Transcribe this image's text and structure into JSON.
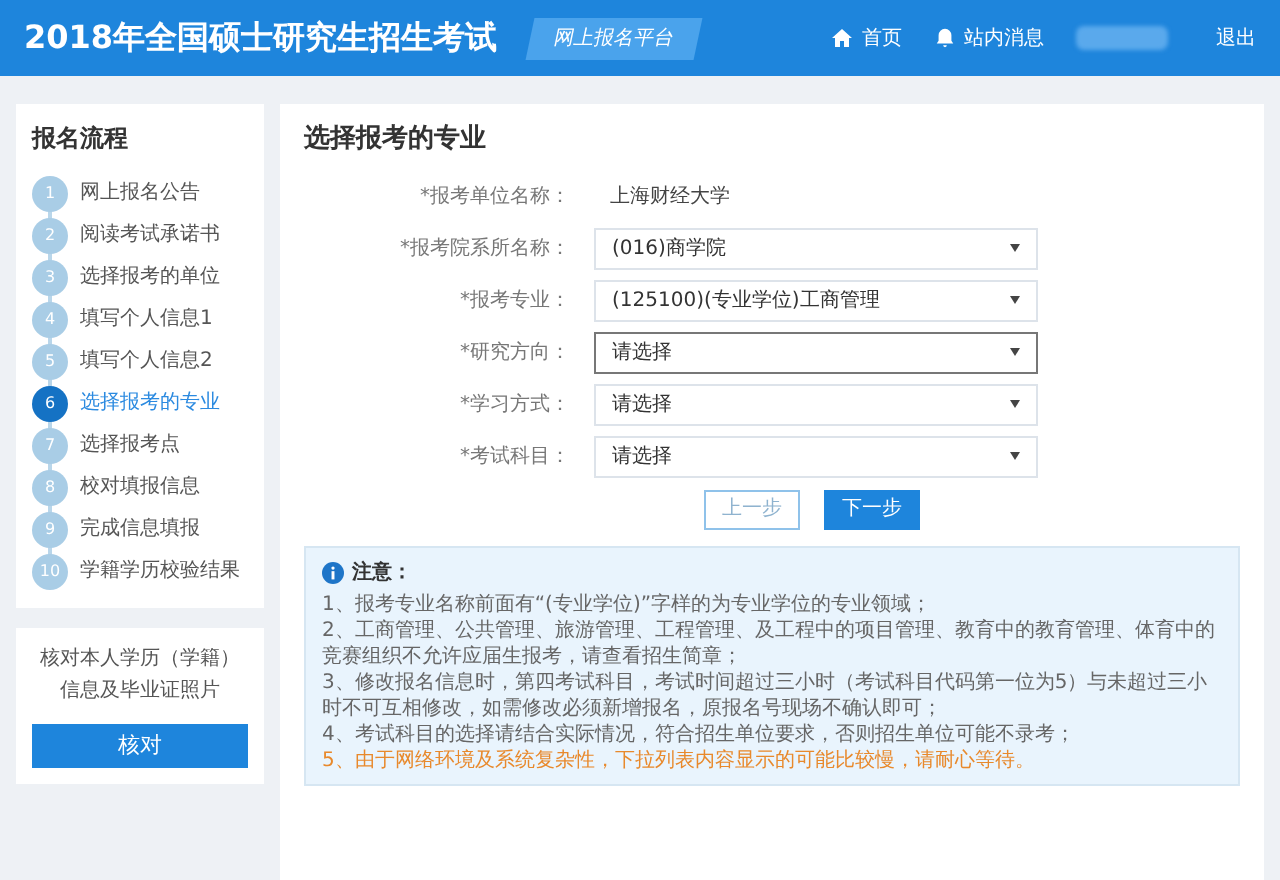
{
  "header": {
    "title": "2018年全国硕士研究生招生考试",
    "platform": "网上报名平台",
    "nav": [
      {
        "kind": "home",
        "label": "首页"
      },
      {
        "kind": "bell",
        "label": "站内消息"
      }
    ],
    "logout": "退出"
  },
  "sidebar": {
    "title": "报名流程",
    "steps": [
      {
        "number": "1",
        "label": "网上报名公告",
        "selected": false
      },
      {
        "number": "2",
        "label": "阅读考试承诺书",
        "selected": false
      },
      {
        "number": "3",
        "label": "选择报考的单位",
        "selected": false
      },
      {
        "number": "4",
        "label": "填写个人信息1",
        "selected": false
      },
      {
        "number": "5",
        "label": "填写个人信息2",
        "selected": false
      },
      {
        "number": "6",
        "label": "选择报考的专业",
        "selected": true
      },
      {
        "number": "7",
        "label": "选择报考点",
        "selected": false
      },
      {
        "number": "8",
        "label": "校对填报信息",
        "selected": false
      },
      {
        "number": "9",
        "label": "完成信息填报",
        "selected": false
      },
      {
        "number": "10",
        "label": "学籍学历校验结果",
        "selected": false
      }
    ]
  },
  "verify_card": {
    "text": "核对本人学历（学籍）信息及毕业证照片",
    "button": "核对"
  },
  "main": {
    "title": "选择报考的专业",
    "fields": [
      {
        "kind": "text",
        "label": "*报考单位名称：",
        "value": "上海财经大学"
      },
      {
        "kind": "select",
        "label": "*报考院系所名称：",
        "value": "(016)商学院",
        "focused": false
      },
      {
        "kind": "select",
        "label": "*报考专业：",
        "value": "(125100)(专业学位)工商管理",
        "focused": false
      },
      {
        "kind": "select",
        "label": "*研究方向：",
        "value": "请选择",
        "focused": true
      },
      {
        "kind": "select",
        "label": "*学习方式：",
        "value": "请选择",
        "focused": false
      },
      {
        "kind": "select",
        "label": "*考试科目：",
        "value": "请选择",
        "focused": false
      }
    ],
    "prev_button": "上一步",
    "next_button": "下一步",
    "notes": {
      "title": "注意：",
      "items": [
        {
          "text": "1、报考专业名称前面有“(专业学位)”字样的为专业学位的专业领域；",
          "warning": false
        },
        {
          "text": "2、工商管理、公共管理、旅游管理、工程管理、及工程中的项目管理、教育中的教育管理、体育中的竞赛组织不允许应届生报考，请查看招生简章；",
          "warning": false
        },
        {
          "text": "3、修改报名信息时，第四考试科目，考试时间超过三小时（考试科目代码第一位为5）与未超过三小时不可互相修改，如需修改必须新增报名，原报名号现场不确认即可；",
          "warning": false
        },
        {
          "text": "4、考试科目的选择请结合实际情况，符合招生单位要求，否则招生单位可能不录考；",
          "warning": false
        },
        {
          "text": "5、由于网络环境及系统复杂性，下拉列表内容显示的可能比较慢，请耐心等待。",
          "warning": true
        }
      ]
    }
  }
}
